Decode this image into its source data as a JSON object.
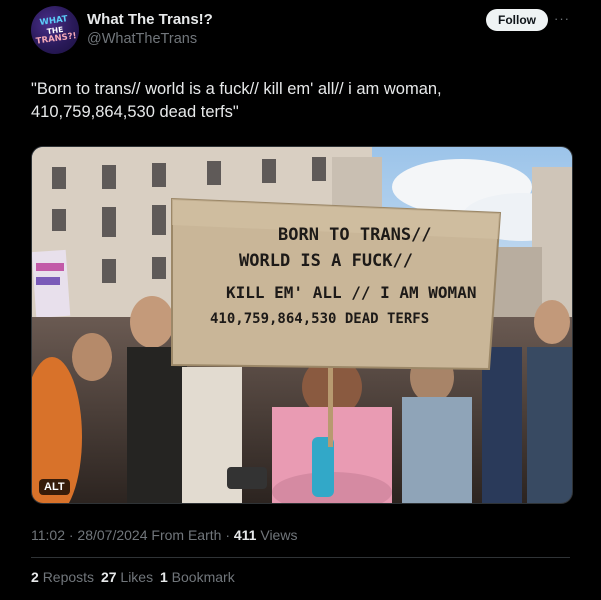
{
  "author": {
    "avatar_text": [
      "WHAT",
      "THE",
      "TRANS?!"
    ],
    "display_name": "What The Trans!?",
    "handle": "@WhatTheTrans"
  },
  "actions": {
    "follow_label": "Follow",
    "more_glyph": "···"
  },
  "tweet": {
    "text_line1": "\"Born to trans// world is a fuck// kill em' all// i am woman,",
    "text_line2": "410,759,864,530 dead terfs\""
  },
  "media": {
    "alt_label": "ALT",
    "sign_lines": [
      "BORN TO TRANS//",
      "WORLD IS A FUCK//",
      "KILL EM' ALL // I AM WOMAN",
      "410,759,864,530 DEAD TERFS"
    ]
  },
  "meta": {
    "timestamp": "11:02 · 28/07/2024 From Earth",
    "separator": "·",
    "views_count": "411",
    "views_label": "Views"
  },
  "stats": {
    "reposts_count": "2",
    "reposts_label": "Reposts",
    "likes_count": "27",
    "likes_label": "Likes",
    "bookmarks_count": "1",
    "bookmarks_label": "Bookmark"
  },
  "colors": {
    "background": "#000000",
    "text": "#e7e9ea",
    "secondary": "#71767b",
    "border": "#2f3336",
    "sign": "#c9b698"
  }
}
